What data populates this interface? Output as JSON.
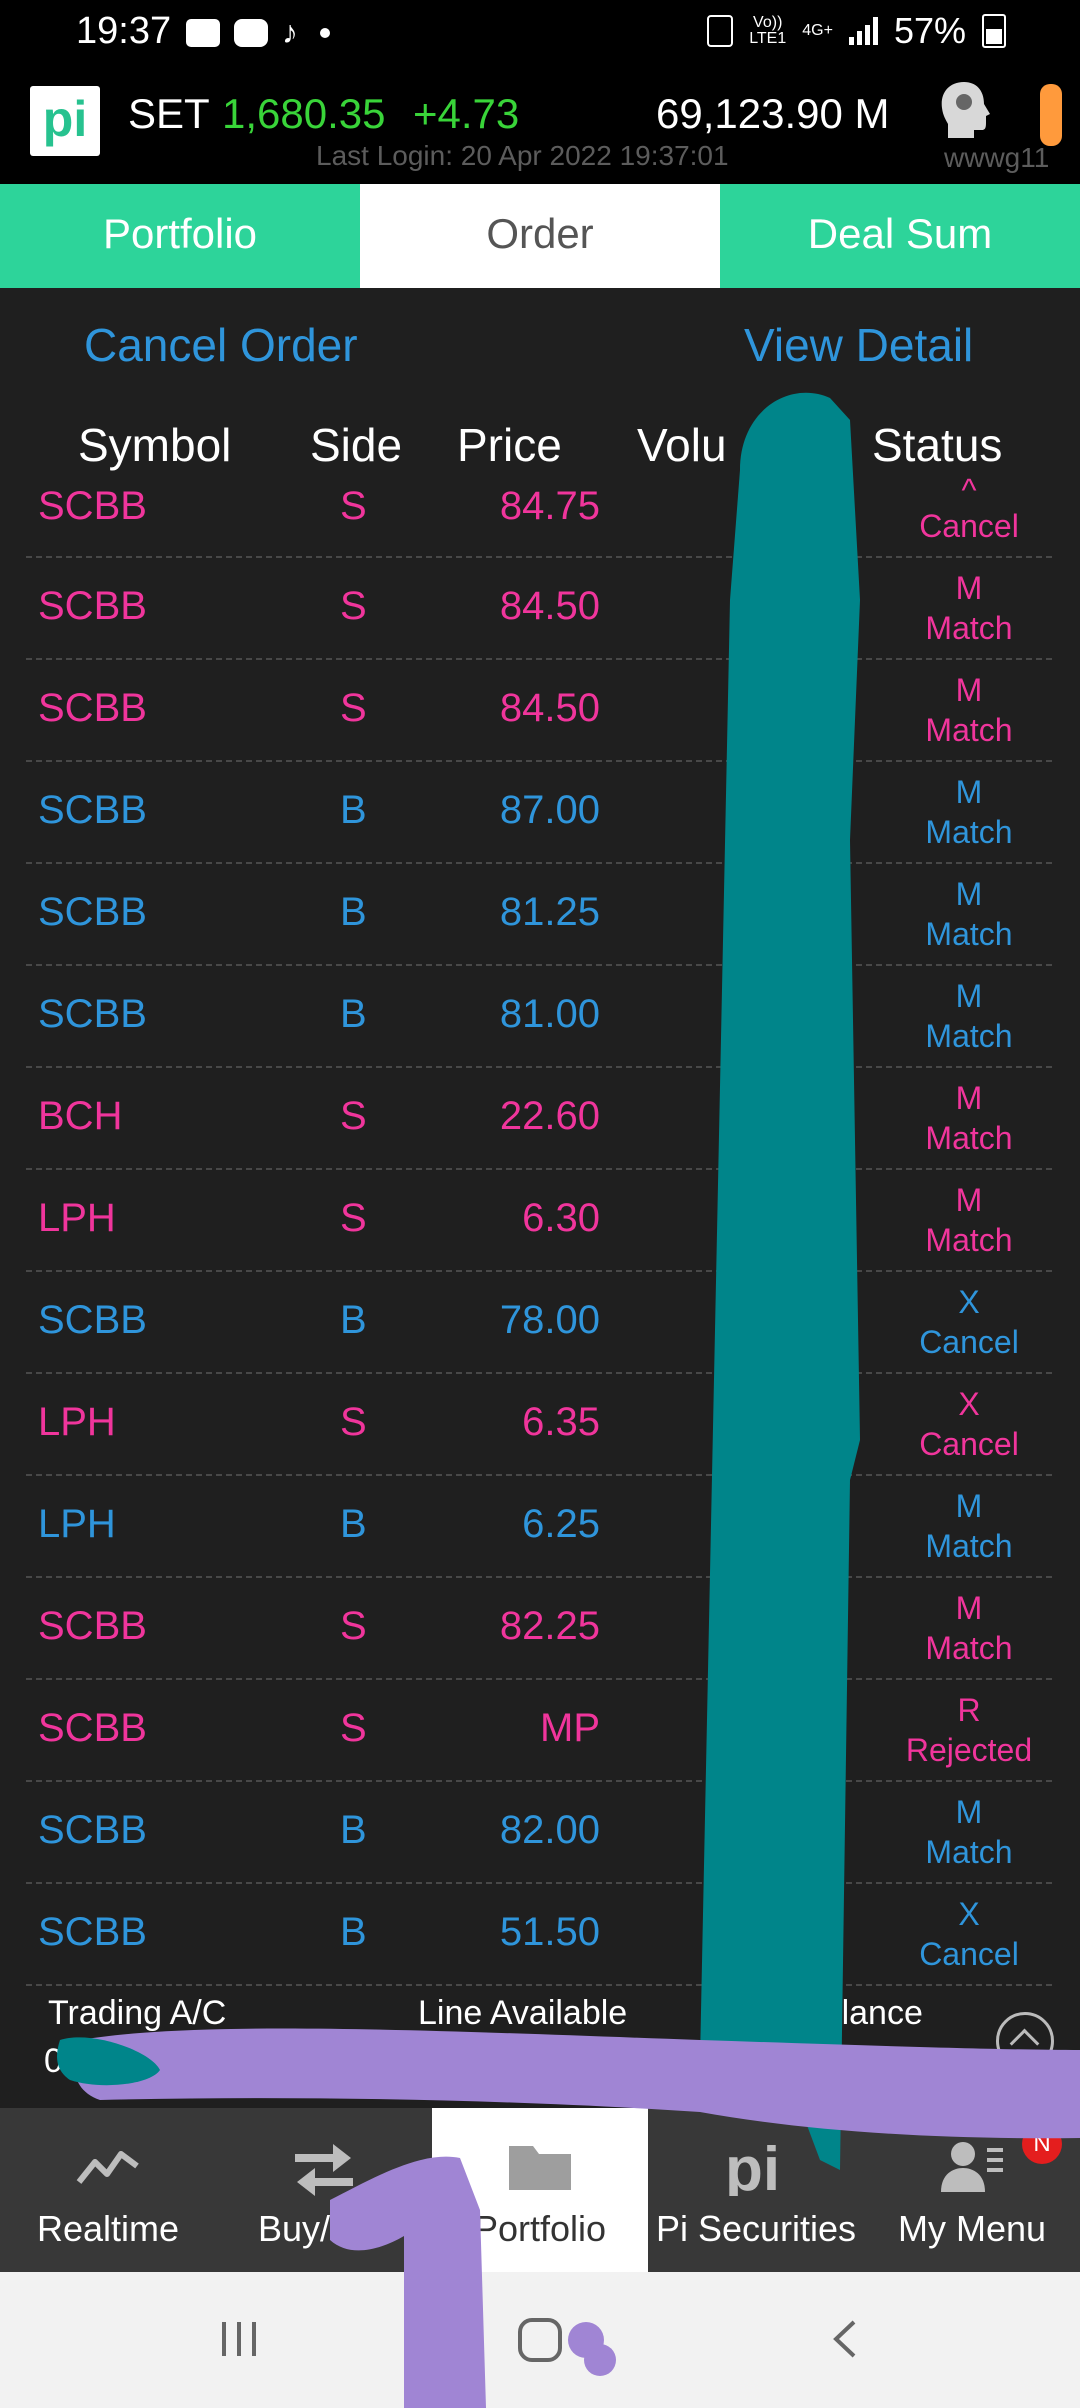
{
  "status_bar": {
    "time": "19:37",
    "net_line1": "Vo))",
    "net_line2": "LTE1",
    "net_type": "4G+",
    "battery": "57%"
  },
  "header": {
    "logo": "pi",
    "index_name": "SET",
    "index_value": "1,680.35",
    "index_change": "+4.73",
    "volume": "69,123.90 M",
    "last_login": "Last Login: 20 Apr 2022 19:37:01",
    "user_id": "wwwg11"
  },
  "tabs": [
    {
      "label": "Portfolio",
      "active": false
    },
    {
      "label": "Order",
      "active": true
    },
    {
      "label": "Deal Sum",
      "active": false
    }
  ],
  "actions": {
    "cancel_order": "Cancel Order",
    "view_detail": "View Detail"
  },
  "table": {
    "headers": {
      "symbol": "Symbol",
      "side": "Side",
      "price": "Price",
      "volume": "Volu",
      "status": "Status"
    },
    "rows": [
      {
        "symbol": "SCBB",
        "side": "S",
        "price": "84.75",
        "code": "^",
        "status": "Cancel"
      },
      {
        "symbol": "SCBB",
        "side": "S",
        "price": "84.50",
        "code": "M",
        "status": "Match"
      },
      {
        "symbol": "SCBB",
        "side": "S",
        "price": "84.50",
        "code": "M",
        "status": "Match"
      },
      {
        "symbol": "SCBB",
        "side": "B",
        "price": "87.00",
        "code": "M",
        "status": "Match"
      },
      {
        "symbol": "SCBB",
        "side": "B",
        "price": "81.25",
        "code": "M",
        "status": "Match"
      },
      {
        "symbol": "SCBB",
        "side": "B",
        "price": "81.00",
        "code": "M",
        "status": "Match"
      },
      {
        "symbol": "BCH",
        "side": "S",
        "price": "22.60",
        "code": "M",
        "status": "Match"
      },
      {
        "symbol": "LPH",
        "side": "S",
        "price": "6.30",
        "code": "M",
        "status": "Match"
      },
      {
        "symbol": "SCBB",
        "side": "B",
        "price": "78.00",
        "code": "X",
        "status": "Cancel"
      },
      {
        "symbol": "LPH",
        "side": "S",
        "price": "6.35",
        "code": "X",
        "status": "Cancel"
      },
      {
        "symbol": "LPH",
        "side": "B",
        "price": "6.25",
        "code": "M",
        "status": "Match"
      },
      {
        "symbol": "SCBB",
        "side": "S",
        "price": "82.25",
        "code": "M",
        "status": "Match"
      },
      {
        "symbol": "SCBB",
        "side": "S",
        "price": "MP",
        "code": "R",
        "status": "Rejected"
      },
      {
        "symbol": "SCBB",
        "side": "B",
        "price": "82.00",
        "code": "M",
        "status": "Match"
      },
      {
        "symbol": "SCBB",
        "side": "B",
        "price": "51.50",
        "code": "X",
        "status": "Cancel"
      }
    ]
  },
  "footer_info": {
    "account_label": "Trading A/C",
    "line_available": "Line Available",
    "balance": "Balance",
    "account_value": "0"
  },
  "bottom_nav": {
    "items": [
      {
        "label": "Realtime",
        "icon": "realtime-chart-icon"
      },
      {
        "label": "Buy/Sell",
        "icon": "buy-sell-arrows-icon"
      },
      {
        "label": "Portfolio",
        "icon": "folder-icon",
        "active": true
      },
      {
        "label": "Pi Securities",
        "icon": "pi-logo-icon"
      },
      {
        "label": "My Menu",
        "icon": "person-menu-icon",
        "badge": "N"
      }
    ]
  },
  "colors": {
    "sell": "#f0359c",
    "buy": "#2f95db",
    "gain": "#39d439",
    "tab_bg": "#2dd49a"
  }
}
